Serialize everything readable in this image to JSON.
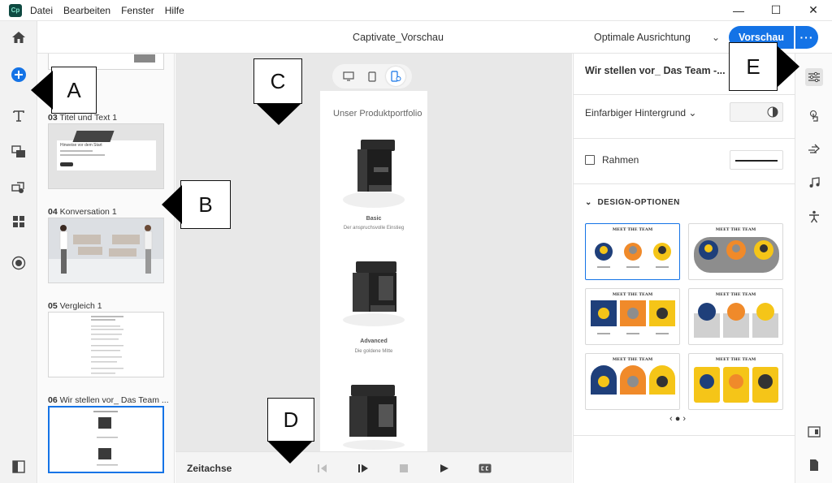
{
  "menu": [
    "Datei",
    "Bearbeiten",
    "Fenster",
    "Hilfe"
  ],
  "app_logo": "Cp",
  "window_controls": [
    "—",
    "☐",
    "✕"
  ],
  "header": {
    "title": "Captivate_Vorschau",
    "orientation": "Optimale Ausrichtung",
    "preview_label": "Vorschau",
    "more_label": "···"
  },
  "slides": [
    {
      "num": "03",
      "title": "Titel und Text 1",
      "thumb_heading": "Hinweise vor dem Start"
    },
    {
      "num": "04",
      "title": "Konversation 1"
    },
    {
      "num": "05",
      "title": "Vergleich 1"
    },
    {
      "num": "06",
      "title": "Wir stellen vor_ Das Team ..."
    }
  ],
  "canvas": {
    "phone_title": "Unser Produktportfolio",
    "products": [
      {
        "name": "Basic",
        "sub": "Der anspruchsvolle Einstieg"
      },
      {
        "name": "Advanced",
        "sub": "Die goldene Mitte"
      }
    ]
  },
  "timeline": {
    "label": "Zeitachse"
  },
  "props": {
    "title": "Wir stellen vor_ Das Team -...",
    "background": "Einfarbiger Hintergrund",
    "border": "Rahmen",
    "design_section": "DESIGN-OPTIONEN",
    "card_title": "MEET THE TEAM",
    "pager": "‹ ● ›"
  },
  "callouts": {
    "a": "A",
    "b": "B",
    "c": "C",
    "d": "D",
    "e": "E"
  },
  "colors": {
    "accent": "#1473e6",
    "yellow": "#f5c518",
    "orange": "#f08a2a",
    "navy": "#1f3f7a",
    "grey": "#8d8d8d"
  }
}
